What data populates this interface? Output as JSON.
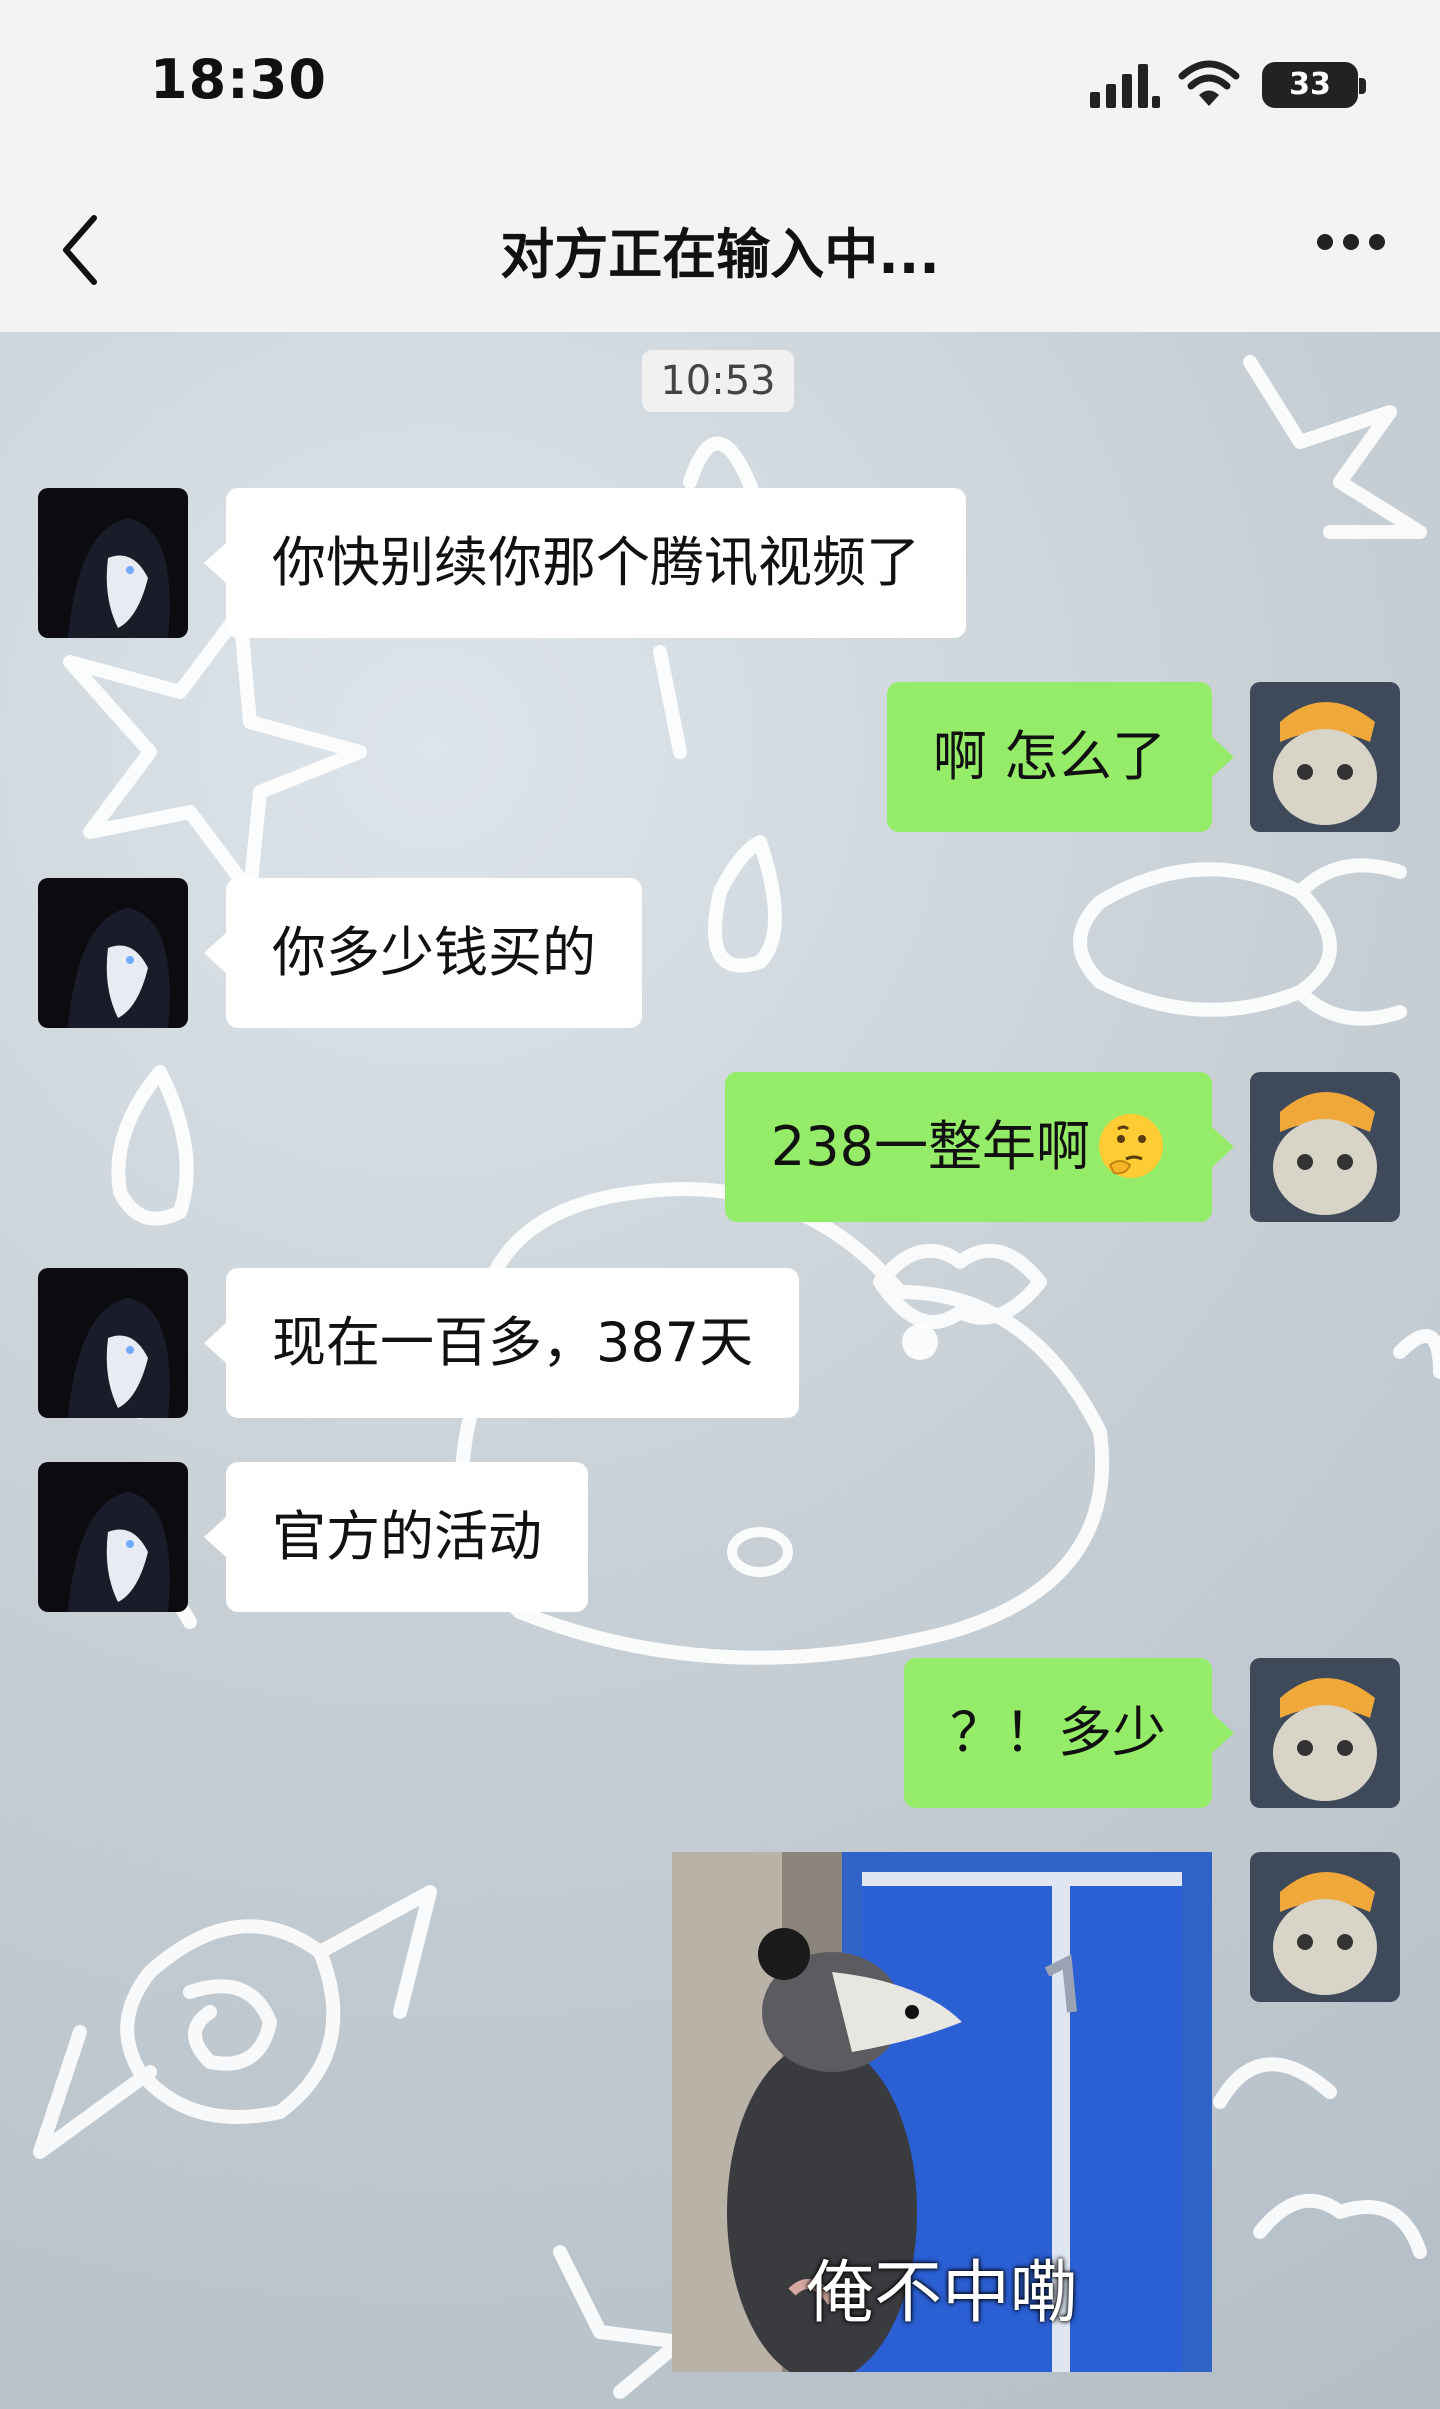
{
  "status_bar": {
    "time": "18:30",
    "battery": "33"
  },
  "nav": {
    "title": "对方正在输入中..."
  },
  "chat": {
    "timestamp": "10:53",
    "messages": [
      {
        "side": "in",
        "text": "你快别续你那个腾讯视频了"
      },
      {
        "side": "out",
        "text": "啊 怎么了"
      },
      {
        "side": "in",
        "text": "你多少钱买的"
      },
      {
        "side": "out",
        "text": "238一整年啊",
        "emoji": "thinking-face-icon"
      },
      {
        "side": "in",
        "text": "现在一百多，387天"
      },
      {
        "side": "in",
        "text": "官方的活动"
      },
      {
        "side": "out",
        "text": "？！多少"
      }
    ],
    "sticker": {
      "caption": "俺不中嘞"
    }
  },
  "colors": {
    "outgoing_bubble": "#95ec69",
    "incoming_bubble": "#ffffff",
    "bar_bg": "#f3f3f3"
  }
}
